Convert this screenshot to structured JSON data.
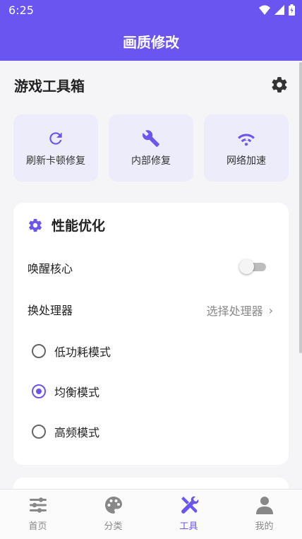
{
  "status": {
    "time": "6:25"
  },
  "appbar": {
    "title": "画质修改"
  },
  "tools": {
    "title": "游戏工具箱",
    "settings_icon": "gear-icon"
  },
  "quick_actions": [
    {
      "label": "刷新卡顿修复",
      "icon": "refresh-icon"
    },
    {
      "label": "内部修复",
      "icon": "wrench-icon"
    },
    {
      "label": "网络加速",
      "icon": "wifi-icon"
    }
  ],
  "performance": {
    "title": "性能优化",
    "wake_core": {
      "label": "唤醒核心",
      "enabled": false
    },
    "processor": {
      "label": "换处理器",
      "value": "选择处理器"
    },
    "modes": [
      {
        "label": "低功耗模式",
        "selected": false
      },
      {
        "label": "均衡模式",
        "selected": true
      },
      {
        "label": "高频模式",
        "selected": false
      }
    ]
  },
  "nav": [
    {
      "label": "首页",
      "icon": "sliders-icon",
      "active": false
    },
    {
      "label": "分类",
      "icon": "palette-icon",
      "active": false
    },
    {
      "label": "工具",
      "icon": "tools-icon",
      "active": true
    },
    {
      "label": "我的",
      "icon": "person-icon",
      "active": false
    }
  ],
  "colors": {
    "accent": "#6b55f0",
    "card_tint": "#ececfb"
  }
}
